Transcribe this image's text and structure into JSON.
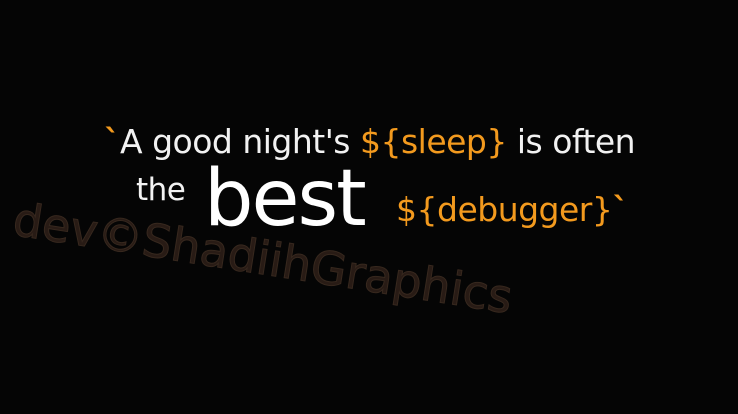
{
  "quote": {
    "open_tick": "`",
    "part1": "A good night's ",
    "var1": "${sleep}",
    "part2": " is often",
    "the": "the",
    "best": "best",
    "var2": "${debugger}",
    "close_tick": "`"
  },
  "watermark": {
    "text": "dev©ShadiihGraphics"
  },
  "colors": {
    "background": "#050505",
    "accent": "#f39a1e",
    "text": "#f2f2f2",
    "watermark": "#2a1d16"
  }
}
